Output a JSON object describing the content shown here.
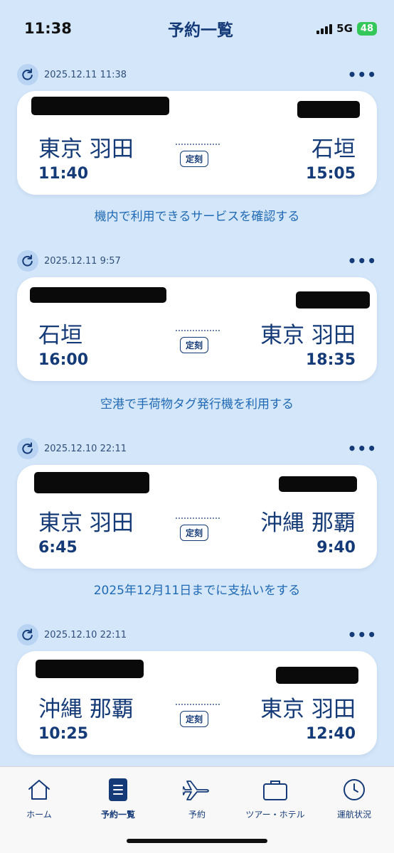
{
  "status": {
    "time": "11:38",
    "network": "5G",
    "battery": "48"
  },
  "header": {
    "title": "予約一覧"
  },
  "reservations": [
    {
      "timestamp": "2025.12.11 11:38",
      "from_city": "東京 羽田",
      "to_city": "石垣",
      "dep_time": "11:40",
      "arr_time": "15:05",
      "status": "定刻",
      "action": "機内で利用できるサービスを確認する"
    },
    {
      "timestamp": "2025.12.11 9:57",
      "from_city": "石垣",
      "to_city": "東京 羽田",
      "dep_time": "16:00",
      "arr_time": "18:35",
      "status": "定刻",
      "action": "空港で手荷物タグ発行機を利用する"
    },
    {
      "timestamp": "2025.12.10 22:11",
      "from_city": "東京 羽田",
      "to_city": "沖縄 那覇",
      "dep_time": "6:45",
      "arr_time": "9:40",
      "status": "定刻",
      "action": "2025年12月11日までに支払いをする"
    },
    {
      "timestamp": "2025.12.10 22:11",
      "from_city": "沖縄 那覇",
      "to_city": "東京 羽田",
      "dep_time": "10:25",
      "arr_time": "12:40",
      "status": "定刻",
      "action": ""
    }
  ],
  "tabs": [
    {
      "label": "ホーム",
      "icon": "home-icon",
      "active": false
    },
    {
      "label": "予約一覧",
      "icon": "list-icon",
      "active": true
    },
    {
      "label": "予約",
      "icon": "airplane-icon",
      "active": false
    },
    {
      "label": "ツアー・ホテル",
      "icon": "suitcase-icon",
      "active": false
    },
    {
      "label": "運航状況",
      "icon": "clock-icon",
      "active": false
    }
  ],
  "colors": {
    "accent": "#143a78",
    "link": "#1f69b5",
    "background": "#d4e6f9"
  }
}
